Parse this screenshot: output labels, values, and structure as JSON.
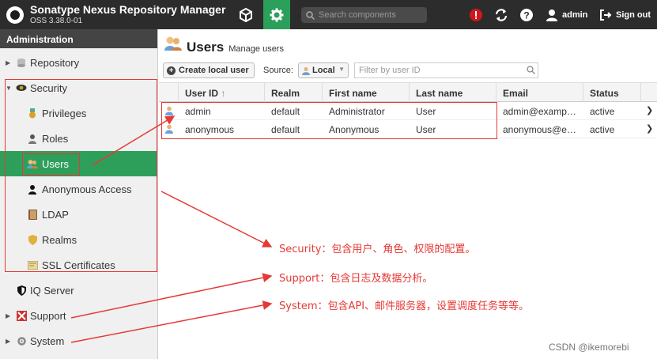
{
  "header": {
    "app_title": "Sonatype Nexus Repository Manager",
    "version": "OSS 3.38.0-01",
    "search_placeholder": "Search components",
    "username": "admin",
    "signout_label": "Sign out"
  },
  "sidebar": {
    "title": "Administration",
    "items": [
      {
        "label": "Repository",
        "icon": "database-icon"
      },
      {
        "label": "Security",
        "icon": "eye-icon"
      },
      {
        "label": "Privileges",
        "icon": "medal-icon"
      },
      {
        "label": "Roles",
        "icon": "user-role-icon"
      },
      {
        "label": "Users",
        "icon": "users-icon"
      },
      {
        "label": "Anonymous Access",
        "icon": "user-icon"
      },
      {
        "label": "LDAP",
        "icon": "book-icon"
      },
      {
        "label": "Realms",
        "icon": "shield-icon"
      },
      {
        "label": "SSL Certificates",
        "icon": "certificate-icon"
      },
      {
        "label": "IQ Server",
        "icon": "shield-icon"
      },
      {
        "label": "Support",
        "icon": "support-icon"
      },
      {
        "label": "System",
        "icon": "gear-icon"
      }
    ]
  },
  "main": {
    "title": "Users",
    "subtitle": "Manage users",
    "create_label": "Create local user",
    "source_label": "Source:",
    "source_value": "Local",
    "filter_placeholder": "Filter by user ID",
    "columns": [
      "User ID",
      "Realm",
      "First name",
      "Last name",
      "Email",
      "Status"
    ],
    "rows": [
      {
        "user_id": "admin",
        "realm": "default",
        "first_name": "Administrator",
        "last_name": "User",
        "email": "admin@example....",
        "status": "active"
      },
      {
        "user_id": "anonymous",
        "realm": "default",
        "first_name": "Anonymous",
        "last_name": "User",
        "email": "anonymous@exa...",
        "status": "active"
      }
    ]
  },
  "annotations": {
    "security": "Security：包含用户、角色、权限的配置。",
    "support": "Support：包含日志及数据分析。",
    "system": "System：包含API、邮件服务器，设置调度任务等等。",
    "watermark": "CSDN @ikemorebi"
  },
  "colors": {
    "accent": "#2e9f5b",
    "topbar": "#2c2c2c",
    "annotation": "#e53935"
  }
}
